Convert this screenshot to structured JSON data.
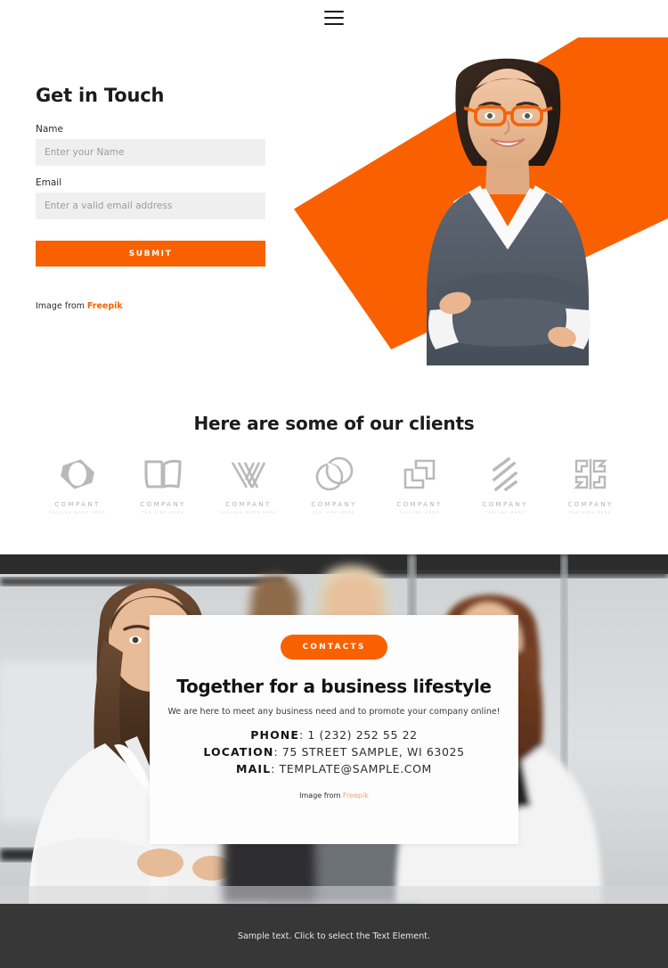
{
  "theme": {
    "accent": "#f96100",
    "footer_bg": "#373737",
    "input_bg": "#efefef",
    "logo_gray": "#b4b4b4"
  },
  "nav": {
    "menu_icon": "hamburger-menu-icon"
  },
  "hero": {
    "title": "Get in Touch",
    "fields": [
      {
        "label": "Name",
        "placeholder": "Enter your Name",
        "value": ""
      },
      {
        "label": "Email",
        "placeholder": "Enter a valid email address",
        "value": ""
      }
    ],
    "submit_label": "SUBMIT",
    "credit_prefix": "Image from ",
    "credit_link": "Freepik",
    "photo_alt": "smiling businesswoman with orange glasses arms crossed"
  },
  "clients": {
    "title": "Here are some of our clients",
    "logos": [
      {
        "name": "COMPANT",
        "tagline": "TAGLINE GOES HERE",
        "mark": "diamond-ring-logo-icon"
      },
      {
        "name": "COMPANY",
        "tagline": "TAG LINE HERE",
        "mark": "open-book-logo-icon"
      },
      {
        "name": "COMPANT",
        "tagline": "TAGLINE GOES HERE",
        "mark": "striped-v-logo-icon"
      },
      {
        "name": "COMPANY",
        "tagline": "TAG LINE HERE",
        "mark": "overlapping-circles-logo-icon"
      },
      {
        "name": "COMPANY",
        "tagline": "TAGLINE HERE",
        "mark": "interlocking-squares-logo-icon"
      },
      {
        "name": "COMPANY",
        "tagline": "TAGLINE HERE",
        "mark": "diagonal-stripes-logo-icon"
      },
      {
        "name": "COMPANY",
        "tagline": "TAG LINE HERE",
        "mark": "mirrored-blocks-logo-icon"
      }
    ]
  },
  "contact": {
    "badge_label": "CONTACTS",
    "heading": "Together for a business lifestyle",
    "subtitle": "We are here to meet any business need and to promote your company online!",
    "details": [
      {
        "label": "PHONE",
        "value": "1 (232) 252 55 22"
      },
      {
        "label": "LOCATION",
        "value": "75 STREET SAMPLE, WI 63025"
      },
      {
        "label": "MAIL",
        "value": "TEMPLATE@SAMPLE.COM"
      }
    ],
    "credit_prefix": "Image from ",
    "credit_link": "Freepik",
    "background_alt": "group of businesswomen in an office"
  },
  "footer": {
    "text": "Sample text. Click to select the Text Element."
  }
}
